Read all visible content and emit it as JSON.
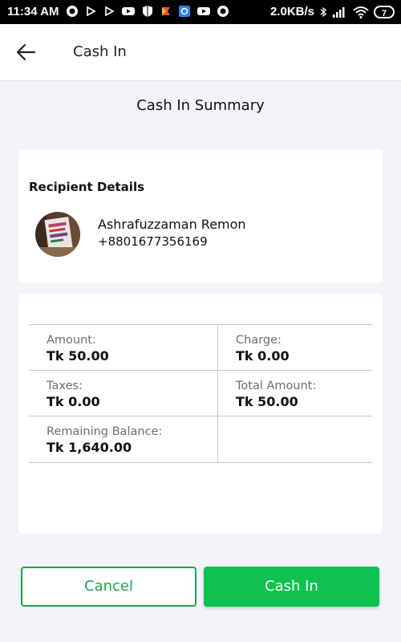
{
  "status_bar": {
    "time": "11:34 AM",
    "network_speed": "2.0KB/s",
    "battery": "7"
  },
  "header": {
    "title": "Cash In"
  },
  "summary": {
    "title": "Cash In Summary"
  },
  "recipient": {
    "heading": "Recipient Details",
    "name": "Ashrafuzzaman Remon",
    "phone": "+8801677356169"
  },
  "details": {
    "amount_label": "Amount:",
    "amount_value": "Tk 50.00",
    "charge_label": "Charge:",
    "charge_value": "Tk 0.00",
    "taxes_label": "Taxes:",
    "taxes_value": "Tk 0.00",
    "total_label": "Total Amount:",
    "total_value": "Tk 50.00",
    "balance_label": "Remaining Balance:",
    "balance_value": "Tk 1,640.00"
  },
  "actions": {
    "cancel_label": "Cancel",
    "confirm_label": "Cash In"
  },
  "colors": {
    "accent": "#0fc24f",
    "accent_border": "#1aa74b",
    "background": "#f3f4f9"
  }
}
